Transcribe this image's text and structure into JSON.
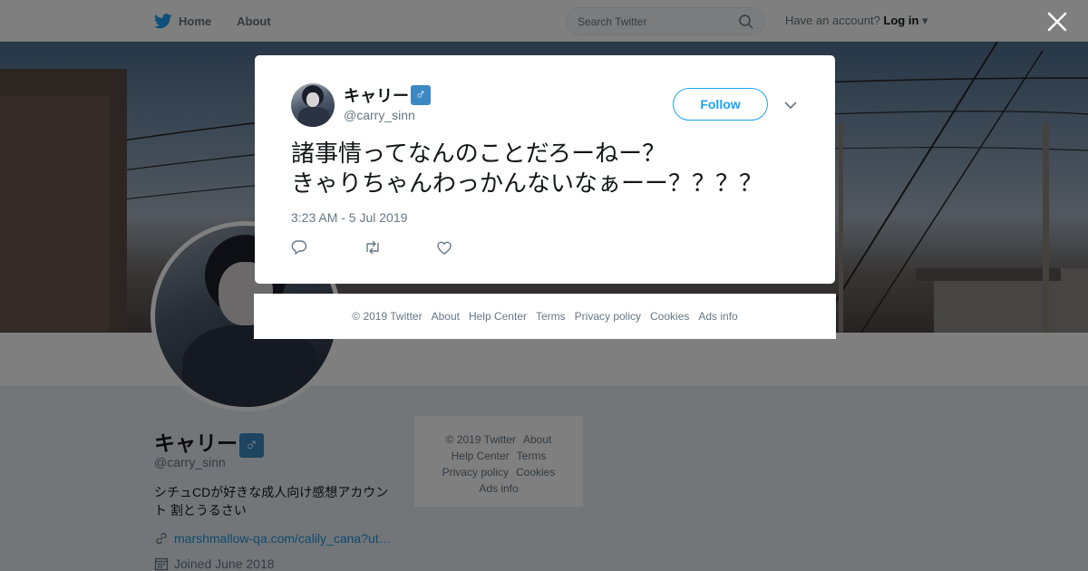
{
  "nav": {
    "home": "Home",
    "about": "About",
    "search_placeholder": "Search Twitter",
    "account_prompt": "Have an account?",
    "login": "Log in"
  },
  "profile": {
    "name": "キャリー",
    "badge": "♂",
    "handle": "@carry_sinn",
    "bio": "シチュCDが好きな成人向け感想アカウント 割とうるさい",
    "link": "marshmallow-qa.com/calily_cana?ut…",
    "joined": "Joined June 2018"
  },
  "side_footer": {
    "line1": [
      "© 2019 Twitter",
      "About"
    ],
    "line2": [
      "Help Center",
      "Terms"
    ],
    "line3": [
      "Privacy policy",
      "Cookies"
    ],
    "line4": [
      "Ads info"
    ]
  },
  "tweet": {
    "name": "キャリー",
    "badge": "♂",
    "handle": "@carry_sinn",
    "follow": "Follow",
    "text": "諸事情ってなんのことだろーねー？\nきゃりちゃんわっかんないなぁーー？？？？",
    "timestamp": "3:23 AM - 5 Jul 2019"
  },
  "modal_footer": {
    "items": [
      "© 2019 Twitter",
      "About",
      "Help Center",
      "Terms",
      "Privacy policy",
      "Cookies",
      "Ads info"
    ]
  },
  "colors": {
    "brand": "#1da1f2",
    "link": "#1b95e0",
    "badge": "#3b88c3"
  }
}
